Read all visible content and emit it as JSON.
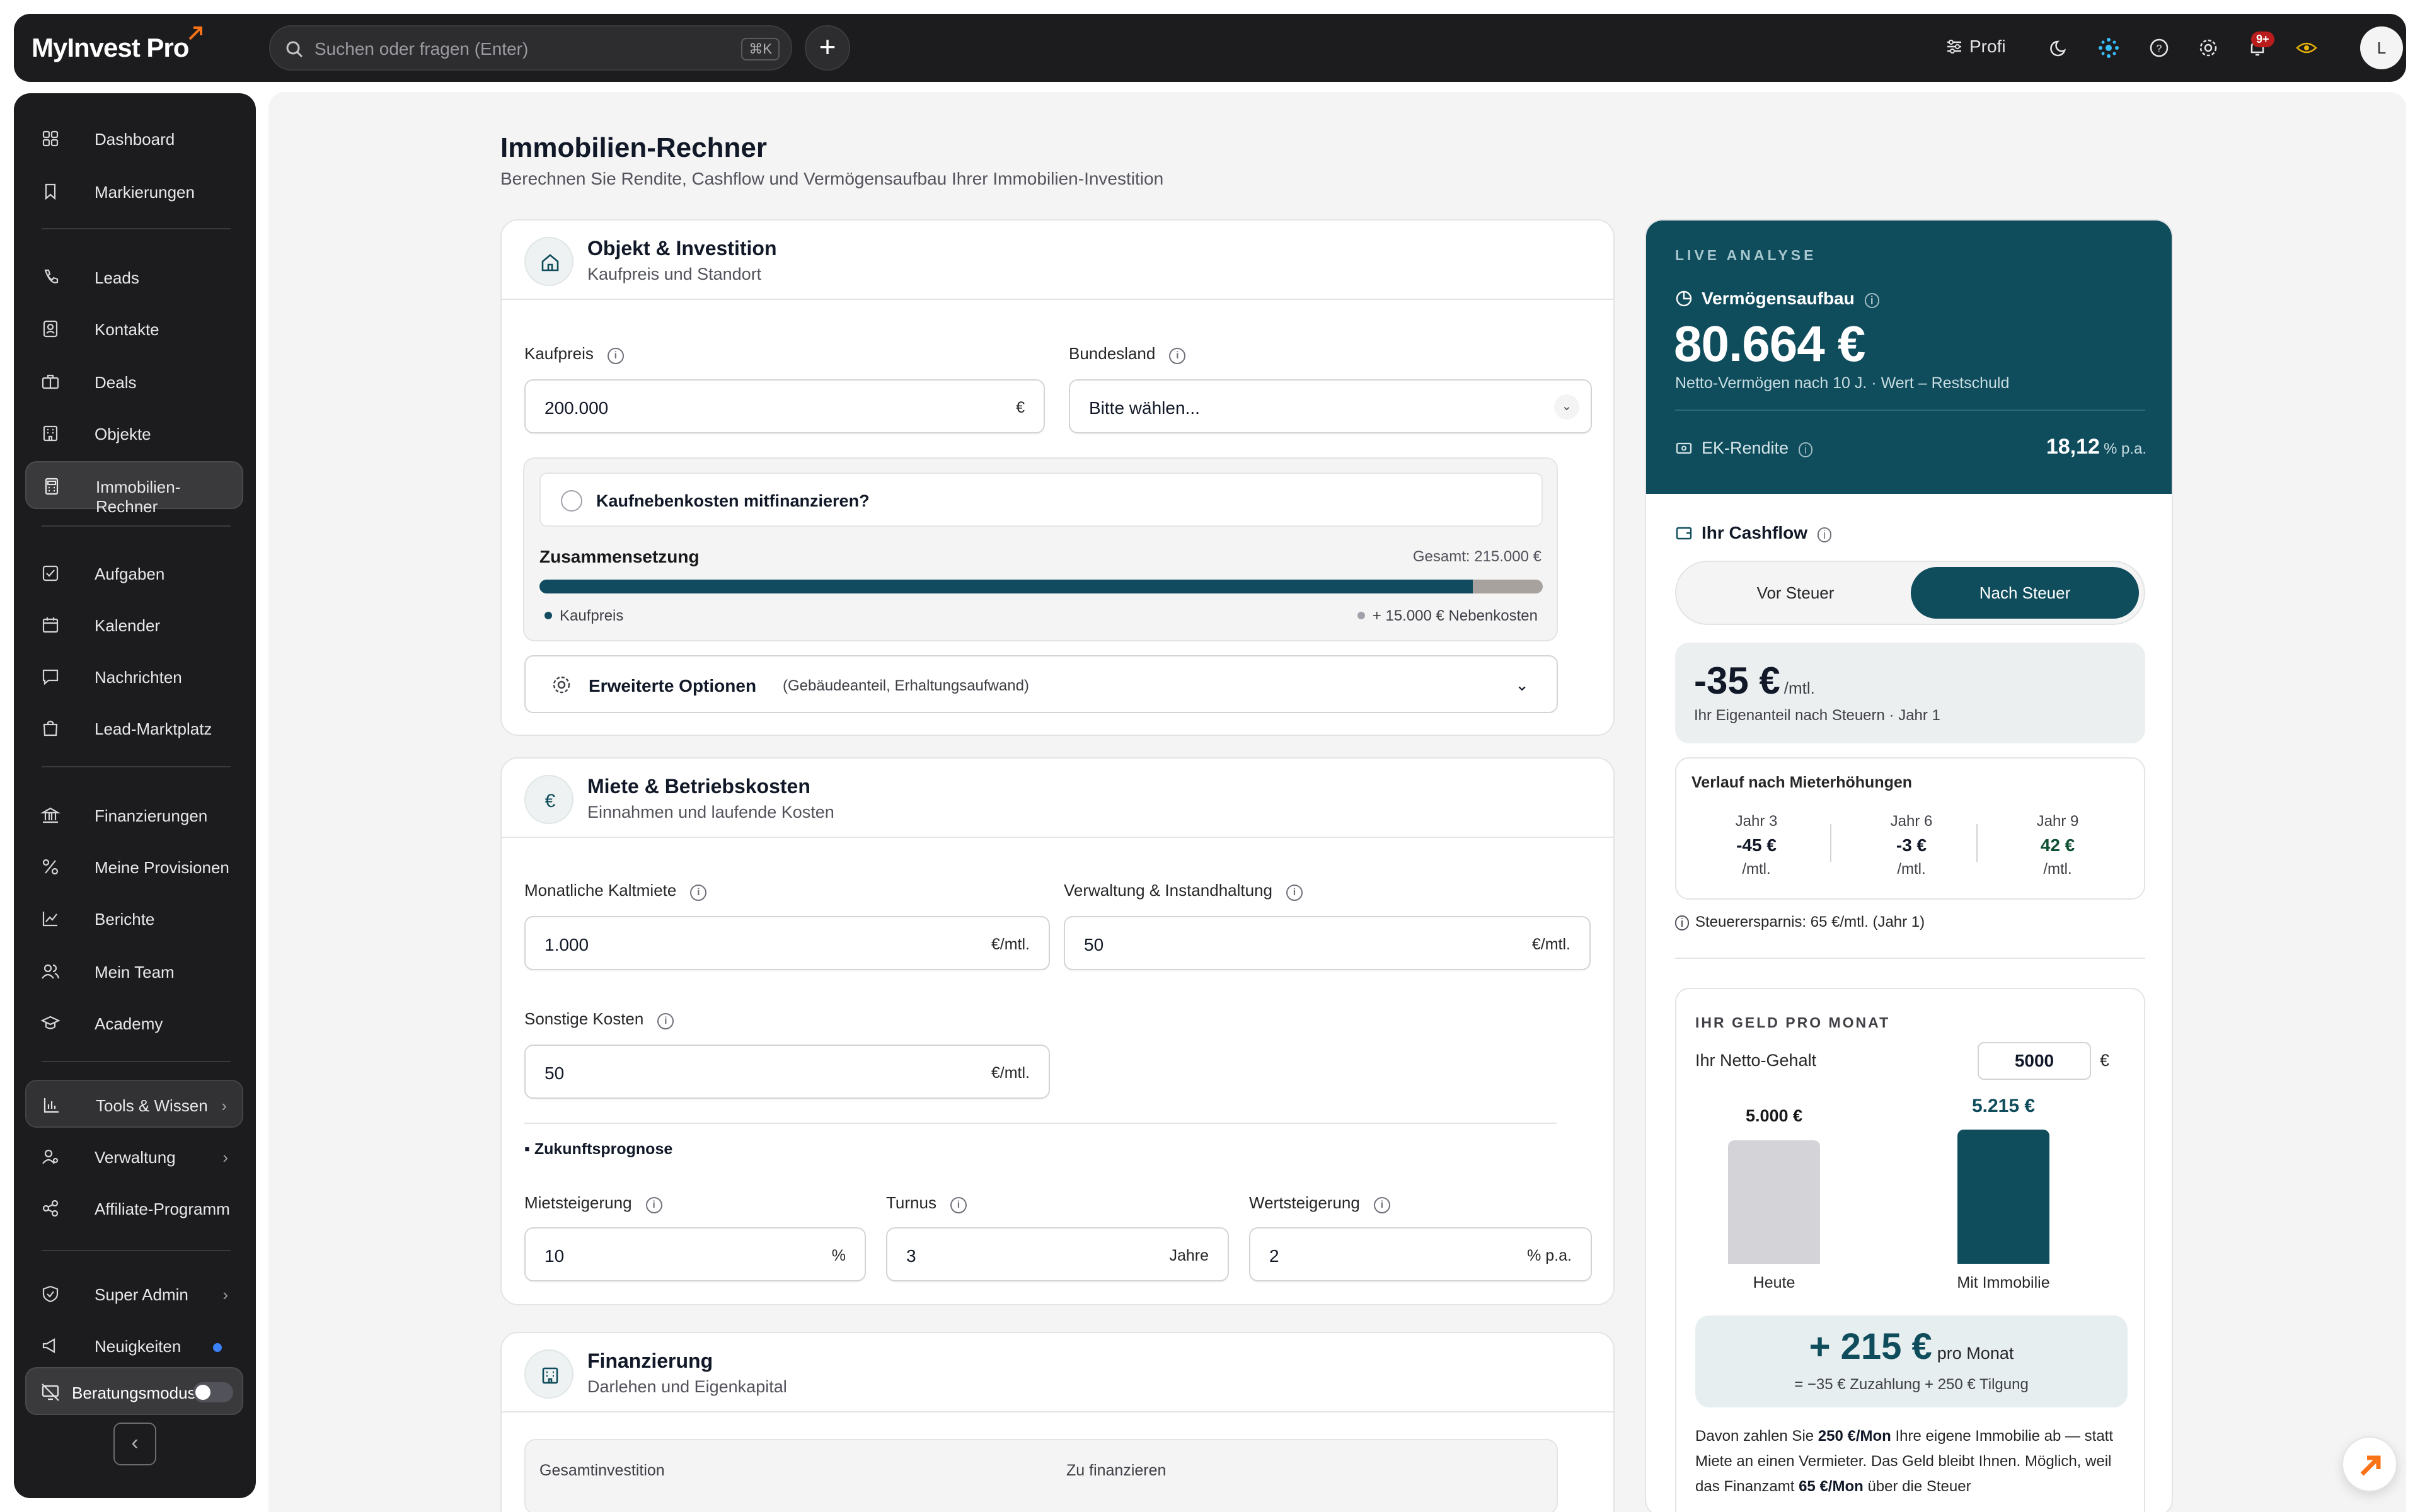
{
  "app": {
    "logo": "MyInvest Pro"
  },
  "topbar": {
    "search_placeholder": "Suchen oder fragen (Enter)",
    "search_shortcut": "⌘K",
    "plus": "+",
    "profile_mode": "Profi",
    "notification_count": "9+",
    "avatar_initial": "L"
  },
  "sidebar": {
    "items": [
      {
        "label": "Dashboard",
        "icon": "grid-icon"
      },
      {
        "label": "Markierungen",
        "icon": "bookmark-icon"
      },
      {
        "label": "Leads",
        "icon": "phone-icon"
      },
      {
        "label": "Kontakte",
        "icon": "contact-icon"
      },
      {
        "label": "Deals",
        "icon": "briefcase-icon"
      },
      {
        "label": "Objekte",
        "icon": "building-icon"
      },
      {
        "label": "Immobilien-Rechner",
        "icon": "calculator-icon"
      },
      {
        "label": "Aufgaben",
        "icon": "check-square-icon"
      },
      {
        "label": "Kalender",
        "icon": "calendar-icon"
      },
      {
        "label": "Nachrichten",
        "icon": "message-icon"
      },
      {
        "label": "Lead-Marktplatz",
        "icon": "shop-icon"
      },
      {
        "label": "Finanzierungen",
        "icon": "bank-icon"
      },
      {
        "label": "Meine Provisionen",
        "icon": "percent-icon"
      },
      {
        "label": "Berichte",
        "icon": "chart-icon"
      },
      {
        "label": "Mein Team",
        "icon": "team-icon"
      },
      {
        "label": "Academy",
        "icon": "graduation-icon"
      },
      {
        "label": "Tools & Wissen",
        "icon": "bar-chart-icon"
      },
      {
        "label": "Verwaltung",
        "icon": "user-cog-icon"
      },
      {
        "label": "Affiliate-Programm",
        "icon": "share-icon"
      },
      {
        "label": "Super Admin",
        "icon": "shield-icon"
      },
      {
        "label": "Neuigkeiten",
        "icon": "megaphone-icon"
      }
    ],
    "beratungsmodus": "Beratungsmodus",
    "collapse": "‹"
  },
  "page": {
    "title": "Immobilien-Rechner",
    "subtitle": "Berechnen Sie Rendite, Cashflow und Vermögensaufbau Ihrer Immobilien-Investition"
  },
  "objekt": {
    "title": "Objekt & Investition",
    "subtitle": "Kaufpreis und Standort",
    "kaufpreis_label": "Kaufpreis",
    "kaufpreis_value": "200.000",
    "kaufpreis_unit": "€",
    "bundesland_label": "Bundesland",
    "bundesland_value": "Bitte wählen...",
    "checkbox_label": "Kaufnebenkosten mitfinanzieren?",
    "zusammensetzung": "Zusammensetzung",
    "gesamt": "Gesamt: 215.000 €",
    "legend_kaufpreis": "Kaufpreis",
    "legend_nebenkosten": "+ 15.000 € Nebenkosten",
    "kaufpreis_share": 0.93,
    "advanced_title": "Erweiterte Optionen",
    "advanced_sub": "(Gebäudeanteil, Erhaltungsaufwand)"
  },
  "miete": {
    "title": "Miete & Betriebskosten",
    "subtitle": "Einnahmen und laufende Kosten",
    "kaltmiete_label": "Monatliche Kaltmiete",
    "kaltmiete_value": "1.000",
    "kaltmiete_unit": "€/mtl.",
    "verwaltung_label": "Verwaltung & Instandhaltung",
    "verwaltung_value": "50",
    "verwaltung_unit": "€/mtl.",
    "sonstige_label": "Sonstige Kosten",
    "sonstige_value": "50",
    "sonstige_unit": "€/mtl.",
    "zukunft": "Zukunftsprognose",
    "mietsteigerung_label": "Mietsteigerung",
    "mietsteigerung_value": "10",
    "mietsteigerung_unit": "%",
    "turnus_label": "Turnus",
    "turnus_value": "3",
    "turnus_unit": "Jahre",
    "wertsteigerung_label": "Wertsteigerung",
    "wertsteigerung_value": "2",
    "wertsteigerung_unit": "% p.a."
  },
  "finanzierung": {
    "title": "Finanzierung",
    "subtitle": "Darlehen und Eigenkapital",
    "gesamtinvestition_label": "Gesamtinvestition",
    "zu_finanzieren_label": "Zu finanzieren"
  },
  "analyse": {
    "live_label": "LIVE ANALYSE",
    "vermoegen_label": "Vermögensaufbau",
    "vermoegen_value": "80.664 €",
    "vermoegen_sub": "Netto-Vermögen nach 10 J. · Wert – Restschuld",
    "ek_label": "EK-Rendite",
    "ek_value": "18,12",
    "ek_unit": "% p.a.",
    "cashflow_title": "Ihr Cashflow",
    "tab_vor": "Vor Steuer",
    "tab_nach": "Nach Steuer",
    "cashflow_value": "-35 €",
    "cashflow_unit": "/mtl.",
    "cashflow_sub": "Ihr Eigenanteil nach Steuern · Jahr 1",
    "verlauf_title": "Verlauf nach Mieterhöhungen",
    "verlauf": [
      {
        "year": "Jahr 3",
        "value": "-45 €",
        "unit": "/mtl."
      },
      {
        "year": "Jahr 6",
        "value": "-3 €",
        "unit": "/mtl."
      },
      {
        "year": "Jahr 9",
        "value": "42 €",
        "unit": "/mtl."
      }
    ],
    "steuer": "Steuerersparnis: 65 €/mtl. (Jahr 1)",
    "geld_title": "IHR GELD PRO MONAT",
    "netto_label": "Ihr Netto-Gehalt",
    "netto_value": "5000",
    "netto_unit": "€",
    "heute_value": "5.000 €",
    "heute_amount": 5000,
    "mit_value": "5.215 €",
    "mit_amount": 5215,
    "heute_label": "Heute",
    "mit_label": "Mit Immobilie",
    "plus_value": "+ 215 €",
    "plus_unit": "pro Monat",
    "plus_sub": "= −35 € Zuzahlung + 250 € Tilgung",
    "para_1": "Davon zahlen Sie ",
    "para_b1": "250 €/Mon",
    "para_2": " Ihre eigene Immobilie ab — statt Miete an einen Vermieter. Das Geld bleibt Ihnen. Möglich, weil das Finanzamt ",
    "para_b2": "65 €/Mon",
    "para_3": " über die Steuer"
  },
  "colors": {
    "primary": "#0f4c5c",
    "dark": "#1c1c1e",
    "accent": "#f97316"
  }
}
